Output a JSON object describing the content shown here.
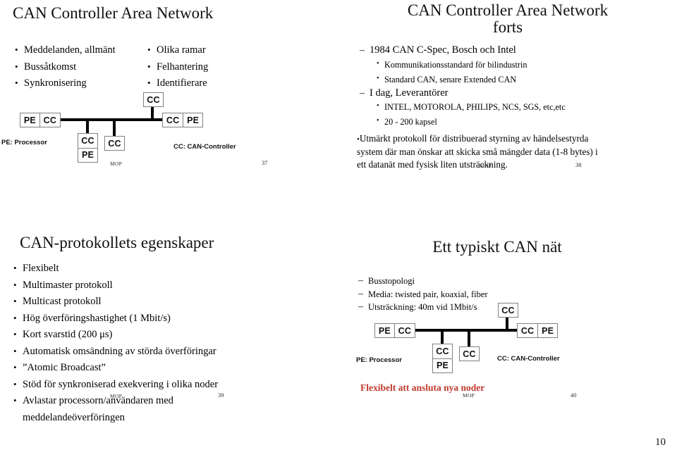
{
  "deck": {
    "page_number": "10"
  },
  "slides": [
    {
      "id": "slide-37",
      "title": "CAN Controller Area Network",
      "bullets_left": [
        "Meddelanden, allmänt",
        "Bussåtkomst",
        "Synkronisering"
      ],
      "bullets_right": [
        "Olika ramar",
        "Felhantering",
        "Identifierare"
      ],
      "diagram": {
        "node_left": [
          "PE",
          "CC"
        ],
        "node_top": [
          "CC"
        ],
        "node_stack": [
          "CC",
          "PE"
        ],
        "node_mid": [
          "CC"
        ],
        "node_right": [
          "CC",
          "PE"
        ],
        "legend_pe": "PE: Processor",
        "legend_cc": "CC: CAN-Controller"
      },
      "footer": "MOP",
      "number": "37"
    },
    {
      "id": "slide-38",
      "title_line1": "CAN Controller Area Network",
      "title_line2": "forts",
      "bullets": [
        {
          "level1": "1984 CAN C-Spec, Bosch och Intel",
          "level2": [
            "Kommunikationsstandard för bilindustrin",
            "Standard CAN, senare Extended CAN"
          ]
        },
        {
          "level1": "I dag, Leverantörer",
          "level2": [
            "INTEL, MOTOROLA, PHILIPS, NCS, SGS, etc,etc",
            "20 - 200 kapsel"
          ]
        }
      ],
      "paragraph": "Utmärkt protokoll för distribuerad styrning av händelsestyrda system där man önskar att skicka små mängder data (1-8 bytes) i ett datanät med fysisk liten utsträckning.",
      "footer": "MOP",
      "number": "38"
    },
    {
      "id": "slide-39",
      "title": "CAN-protokollets egenskaper",
      "bullets": [
        "Flexibelt",
        "Multimaster protokoll",
        "Multicast protokoll",
        "Hög överföringshastighet (1 Mbit/s)",
        "Kort svarstid (200 μs)",
        "Automatisk omsändning av störda överföringar",
        "”Atomic Broadcast”",
        "Stöd för synkroniserad exekvering i olika noder",
        "Avlastar processorn/användaren med meddelandeöverföringen"
      ],
      "footer": "MOP",
      "number": "39"
    },
    {
      "id": "slide-40",
      "title": "Ett typiskt CAN nät",
      "bullets": [
        "Busstopologi",
        "Media: twisted pair, koaxial, fiber",
        "Utsträckning: 40m vid 1Mbit/s"
      ],
      "diagram": {
        "node_left": [
          "PE",
          "CC"
        ],
        "node_top": [
          "CC"
        ],
        "node_stack": [
          "CC",
          "PE"
        ],
        "node_mid": [
          "CC"
        ],
        "node_right": [
          "CC",
          "PE"
        ],
        "legend_pe": "PE: Processor",
        "legend_cc": "CC: CAN-Controller"
      },
      "red_note": "Flexibelt att ansluta nya noder",
      "red_color": "#c0392b",
      "footer": "MOP",
      "number": "40"
    }
  ]
}
